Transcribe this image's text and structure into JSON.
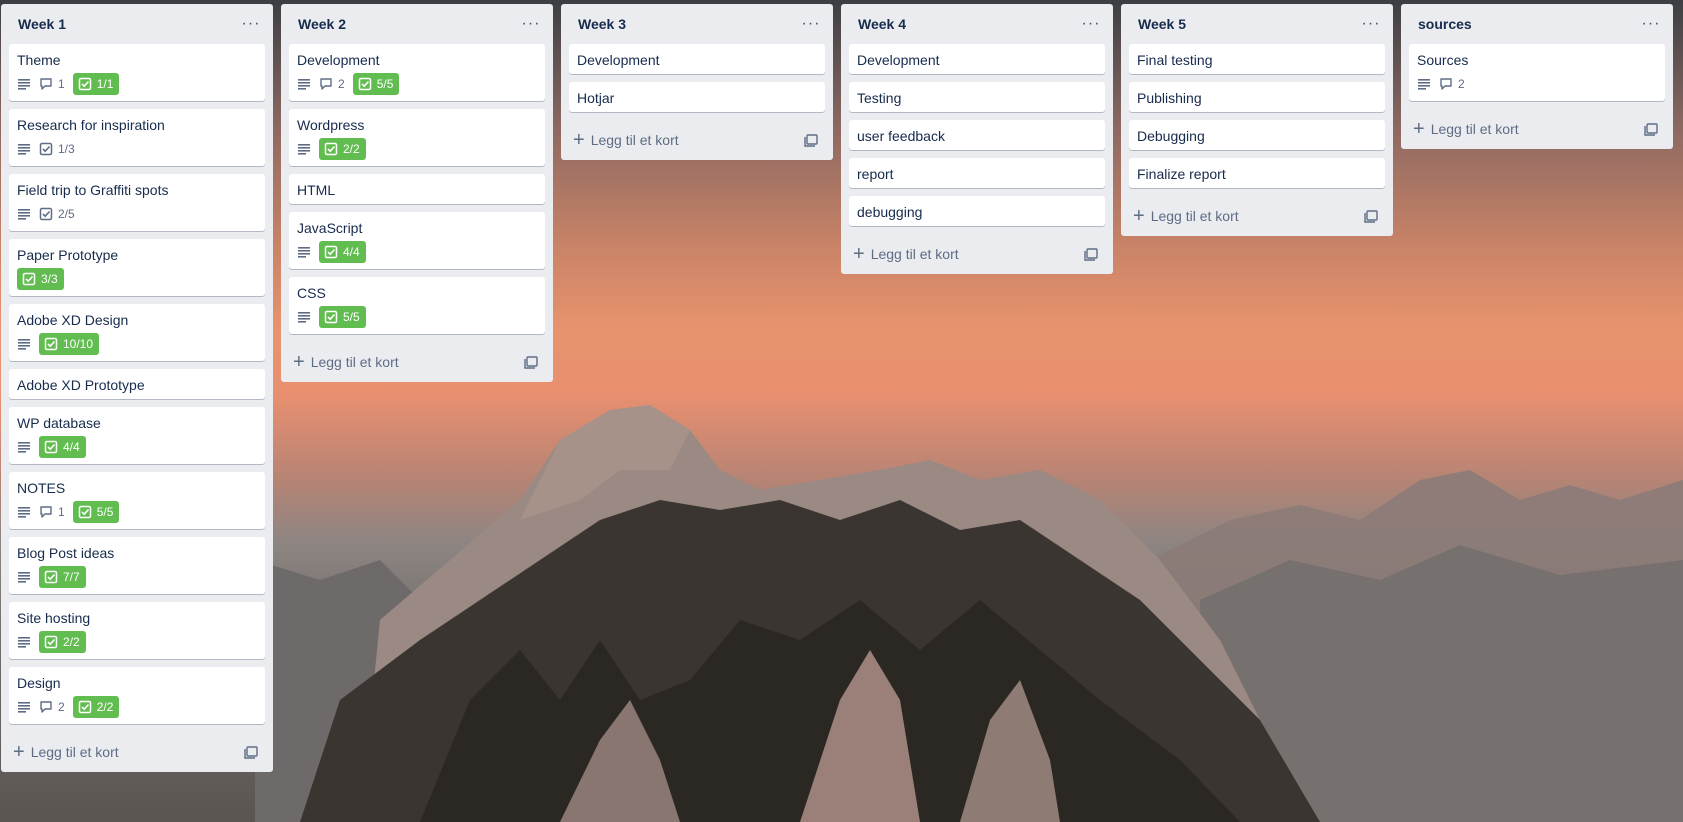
{
  "lists": [
    {
      "title": "Week 1",
      "cards": [
        {
          "title": "Theme",
          "desc": true,
          "comments": "1",
          "checklist": "1/1",
          "done": true
        },
        {
          "title": "Research for inspiration",
          "desc": true,
          "comments": null,
          "checklist": "1/3",
          "done": false
        },
        {
          "title": "Field trip to Graffiti spots",
          "desc": true,
          "comments": null,
          "checklist": "2/5",
          "done": false
        },
        {
          "title": "Paper Prototype",
          "desc": false,
          "comments": null,
          "checklist": "3/3",
          "done": true
        },
        {
          "title": "Adobe XD Design",
          "desc": true,
          "comments": null,
          "checklist": "10/10",
          "done": true
        },
        {
          "title": "Adobe XD Prototype",
          "desc": false,
          "comments": null,
          "checklist": null,
          "done": false
        },
        {
          "title": "WP database",
          "desc": true,
          "comments": null,
          "checklist": "4/4",
          "done": true
        },
        {
          "title": "NOTES",
          "desc": true,
          "comments": "1",
          "checklist": "5/5",
          "done": true
        },
        {
          "title": "Blog Post ideas",
          "desc": true,
          "comments": null,
          "checklist": "7/7",
          "done": true
        },
        {
          "title": "Site hosting",
          "desc": true,
          "comments": null,
          "checklist": "2/2",
          "done": true
        },
        {
          "title": "Design",
          "desc": true,
          "comments": "2",
          "checklist": "2/2",
          "done": true
        }
      ]
    },
    {
      "title": "Week 2",
      "cards": [
        {
          "title": "Development",
          "desc": true,
          "comments": "2",
          "checklist": "5/5",
          "done": true
        },
        {
          "title": "Wordpress",
          "desc": true,
          "comments": null,
          "checklist": "2/2",
          "done": true
        },
        {
          "title": "HTML",
          "desc": false,
          "comments": null,
          "checklist": null,
          "done": false
        },
        {
          "title": "JavaScript",
          "desc": true,
          "comments": null,
          "checklist": "4/4",
          "done": true
        },
        {
          "title": "CSS",
          "desc": true,
          "comments": null,
          "checklist": "5/5",
          "done": true
        }
      ]
    },
    {
      "title": "Week 3",
      "cards": [
        {
          "title": "Development",
          "desc": false,
          "comments": null,
          "checklist": null,
          "done": false
        },
        {
          "title": "Hotjar",
          "desc": false,
          "comments": null,
          "checklist": null,
          "done": false
        }
      ]
    },
    {
      "title": "Week 4",
      "cards": [
        {
          "title": "Development",
          "desc": false,
          "comments": null,
          "checklist": null,
          "done": false
        },
        {
          "title": "Testing",
          "desc": false,
          "comments": null,
          "checklist": null,
          "done": false
        },
        {
          "title": "user feedback",
          "desc": false,
          "comments": null,
          "checklist": null,
          "done": false
        },
        {
          "title": "report",
          "desc": false,
          "comments": null,
          "checklist": null,
          "done": false
        },
        {
          "title": "debugging",
          "desc": false,
          "comments": null,
          "checklist": null,
          "done": false
        }
      ]
    },
    {
      "title": "Week 5",
      "cards": [
        {
          "title": "Final testing",
          "desc": false,
          "comments": null,
          "checklist": null,
          "done": false
        },
        {
          "title": "Publishing",
          "desc": false,
          "comments": null,
          "checklist": null,
          "done": false
        },
        {
          "title": "Debugging",
          "desc": false,
          "comments": null,
          "checklist": null,
          "done": false
        },
        {
          "title": "Finalize report",
          "desc": false,
          "comments": null,
          "checklist": null,
          "done": false
        }
      ]
    },
    {
      "title": "sources",
      "cards": [
        {
          "title": "Sources",
          "desc": true,
          "comments": "2",
          "checklist": null,
          "done": false
        }
      ]
    }
  ],
  "add_card_label": "Legg til et kort",
  "list_menu_icon": "ellipsis-icon",
  "colors": {
    "list_bg": "#ebecf0",
    "badge_complete": "#61bd4f",
    "text": "#172b4d",
    "muted": "#5e6c84"
  }
}
